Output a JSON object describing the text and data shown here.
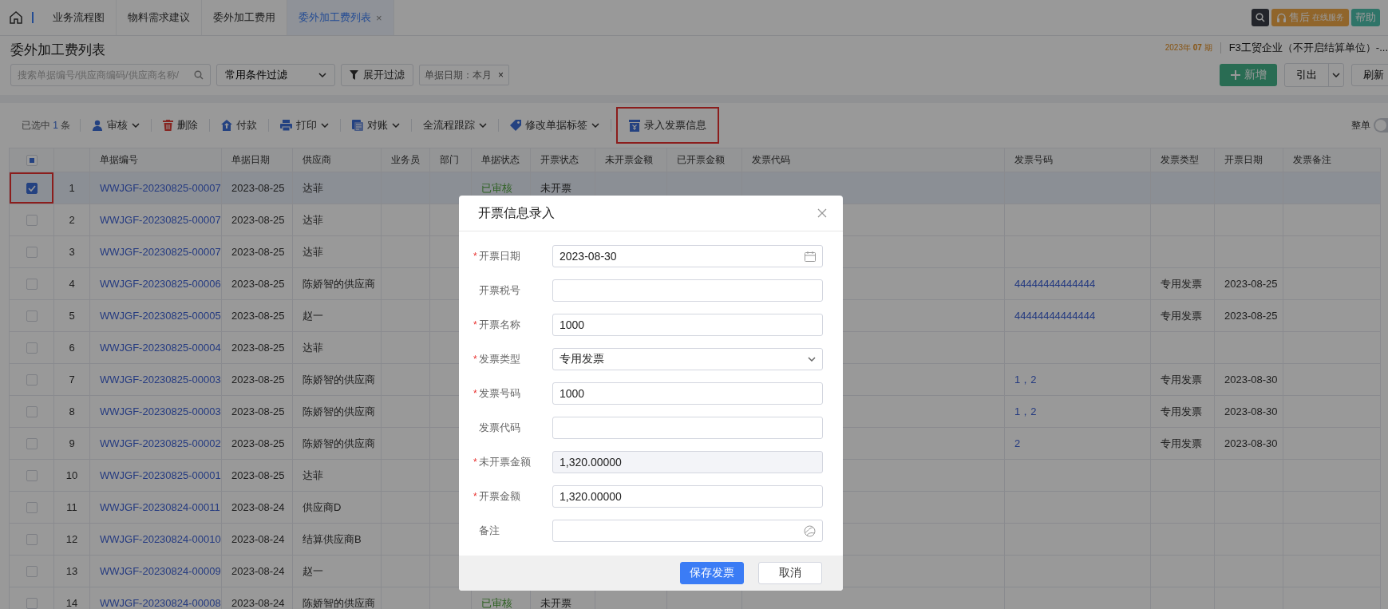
{
  "top_bar": {
    "tabs": [
      {
        "label": "业务流程图",
        "selected": false
      },
      {
        "label": "物料需求建议",
        "selected": false
      },
      {
        "label": "委外加工费用",
        "selected": false
      },
      {
        "label": "委外加工费列表",
        "selected": true,
        "close": "×"
      }
    ],
    "service_button": {
      "main": "售后",
      "sub": "在线服务"
    },
    "help_button": "帮助"
  },
  "header": {
    "title": "委外加工费列表",
    "period": "2023年 **07** 期",
    "company": "F3工贸企业（不开启结算单位）-..."
  },
  "filters": {
    "search_placeholder": "搜索单据编号/供应商编码/供应商名称/",
    "condition_select": "常用条件过滤",
    "expand_button": "展开过滤",
    "tags": [
      {
        "label": "单据日期：本月",
        "close": "×"
      }
    ]
  },
  "actions": {
    "add": "新增",
    "export": "引出",
    "refresh": "刷新"
  },
  "toolbar": {
    "selection": {
      "prefix": "已选中",
      "count": "1",
      "suffix": "条"
    },
    "items": [
      {
        "label": "审核",
        "dropdown": true,
        "highlighted": false
      },
      {
        "label": "删除",
        "dropdown": false,
        "highlighted": false
      },
      {
        "label": "付款",
        "dropdown": false,
        "highlighted": false
      },
      {
        "label": "打印",
        "dropdown": true,
        "highlighted": false
      },
      {
        "label": "对账",
        "dropdown": true,
        "highlighted": false
      },
      {
        "label": "全流程跟踪",
        "dropdown": true,
        "highlighted": false
      },
      {
        "label": "修改单据标签",
        "dropdown": true,
        "highlighted": false
      },
      {
        "label": "录入发票信息",
        "dropdown": false,
        "highlighted": true
      }
    ],
    "whole_toggle": {
      "label": "整单",
      "on": false
    }
  },
  "table": {
    "header_checkbox": {
      "partial": true
    },
    "columns": [
      {
        "label": "单据编号"
      },
      {
        "label": "单据日期"
      },
      {
        "label": "供应商"
      },
      {
        "label": "业务员"
      },
      {
        "label": "部门"
      },
      {
        "label": "单据状态"
      },
      {
        "label": "开票状态"
      },
      {
        "label": "未开票金额"
      },
      {
        "label": "已开票金额"
      },
      {
        "label": "发票代码"
      },
      {
        "label": "发票号码"
      },
      {
        "label": "发票类型"
      },
      {
        "label": "开票日期"
      },
      {
        "label": "发票备注"
      }
    ],
    "rows": [
      {
        "index": "1",
        "selected": true,
        "highlighted": true,
        "number": "WWJGF-20230825-00007",
        "date": "2023-08-25",
        "supplier": "达菲",
        "status": "已审核",
        "invoice_status": "未开票"
      },
      {
        "index": "2",
        "selected": false,
        "highlighted": false,
        "number": "WWJGF-20230825-00007",
        "date": "2023-08-25",
        "supplier": "达菲"
      },
      {
        "index": "3",
        "selected": false,
        "highlighted": false,
        "number": "WWJGF-20230825-00007",
        "date": "2023-08-25",
        "supplier": "达菲"
      },
      {
        "index": "4",
        "selected": false,
        "highlighted": false,
        "number": "WWJGF-20230825-00006",
        "date": "2023-08-25",
        "supplier": "陈娇智的供应商",
        "invoice_no": "44444444444444",
        "invoice_type": "专用发票",
        "invoice_date": "2023-08-25"
      },
      {
        "index": "5",
        "selected": false,
        "highlighted": false,
        "number": "WWJGF-20230825-00005",
        "date": "2023-08-25",
        "supplier": "赵一",
        "invoice_no": "44444444444444",
        "invoice_type": "专用发票",
        "invoice_date": "2023-08-25"
      },
      {
        "index": "6",
        "selected": false,
        "highlighted": false,
        "number": "WWJGF-20230825-00004",
        "date": "2023-08-25",
        "supplier": "达菲"
      },
      {
        "index": "7",
        "selected": false,
        "highlighted": false,
        "number": "WWJGF-20230825-00003",
        "date": "2023-08-25",
        "supplier": "陈娇智的供应商",
        "invoice_no": "1，2",
        "invoice_type": "专用发票",
        "invoice_date": "2023-08-30"
      },
      {
        "index": "8",
        "selected": false,
        "highlighted": false,
        "number": "WWJGF-20230825-00003",
        "date": "2023-08-25",
        "supplier": "陈娇智的供应商",
        "invoice_no": "1，2",
        "invoice_type": "专用发票",
        "invoice_date": "2023-08-30"
      },
      {
        "index": "9",
        "selected": false,
        "highlighted": false,
        "number": "WWJGF-20230825-00002",
        "date": "2023-08-25",
        "supplier": "陈娇智的供应商",
        "invoice_no": "2",
        "invoice_type": "专用发票",
        "invoice_date": "2023-08-30"
      },
      {
        "index": "10",
        "selected": false,
        "highlighted": false,
        "number": "WWJGF-20230825-00001",
        "date": "2023-08-25",
        "supplier": "达菲"
      },
      {
        "index": "11",
        "selected": false,
        "highlighted": false,
        "number": "WWJGF-20230824-00011",
        "date": "2023-08-24",
        "supplier": "供应商D"
      },
      {
        "index": "12",
        "selected": false,
        "highlighted": false,
        "number": "WWJGF-20230824-00010",
        "date": "2023-08-24",
        "supplier": "结算供应商B"
      },
      {
        "index": "13",
        "selected": false,
        "highlighted": false,
        "number": "WWJGF-20230824-00009",
        "date": "2023-08-24",
        "supplier": "赵一"
      },
      {
        "index": "14",
        "selected": false,
        "highlighted": false,
        "number": "WWJGF-20230824-00008",
        "date": "2023-08-24",
        "supplier": "陈娇智的供应商",
        "status": "已审核",
        "invoice_status": "未开票"
      }
    ]
  },
  "dialog": {
    "title": "开票信息录入",
    "fields": [
      {
        "label": "开票日期",
        "mark": "*",
        "kind": "date",
        "value": "2023-08-30"
      },
      {
        "label": "开票税号",
        "kind": "text"
      },
      {
        "label": "开票名称",
        "mark": "*",
        "kind": "text",
        "value": "1000"
      },
      {
        "label": "发票类型",
        "mark": "*",
        "kind": "select",
        "value": "专用发票"
      },
      {
        "label": "发票号码",
        "mark": "*",
        "kind": "text",
        "value": "1000"
      },
      {
        "label": "发票代码",
        "kind": "text"
      },
      {
        "label": "未开票金额",
        "mark": "*",
        "kind": "readonly",
        "value": "1,320.00000"
      },
      {
        "label": "开票金额",
        "mark": "*",
        "kind": "text",
        "value": "1,320.00000"
      },
      {
        "label": "备注",
        "kind": "remark"
      }
    ],
    "buttons": [
      {
        "label": "保存发票",
        "primary": true
      },
      {
        "label": "取消",
        "primary": false
      }
    ]
  }
}
